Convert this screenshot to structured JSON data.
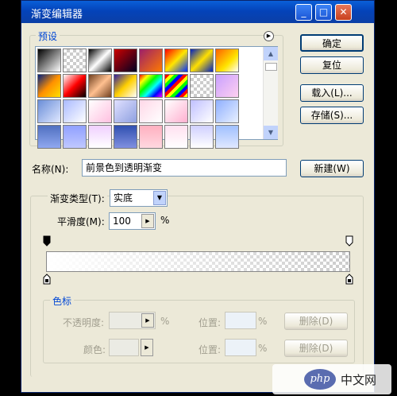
{
  "window": {
    "title": "渐变编辑器",
    "title_buttons": {
      "minimize": "_",
      "maximize": "□",
      "close": "✕"
    }
  },
  "buttons": {
    "ok": "确定",
    "reset": "复位",
    "load": "载入(L)...",
    "save": "存储(S)...",
    "new": "新建(W)"
  },
  "presets": {
    "label": "预设",
    "menu_icon": "circle-arrow-icon"
  },
  "name": {
    "label": "名称(N):",
    "value": "前景色到透明渐变"
  },
  "gradient": {
    "type_label": "渐变类型(T):",
    "type_value": "实底",
    "smoothness_label": "平滑度(M):",
    "smoothness_value": "100",
    "smoothness_unit": "%",
    "color_a": "#ffffff",
    "color_b": "transparent"
  },
  "stops": {
    "label": "色标",
    "opacity_label": "不透明度:",
    "opacity_unit": "%",
    "position_label": "位置:",
    "position_unit": "%",
    "delete_label": "删除(D)",
    "color_label": "颜色:"
  },
  "watermark": {
    "text": "中文网",
    "logo": "php"
  },
  "colors": {
    "title_blue": "#0443b9",
    "dialog_bg": "#ece9d8",
    "group_label": "#0046d5"
  }
}
